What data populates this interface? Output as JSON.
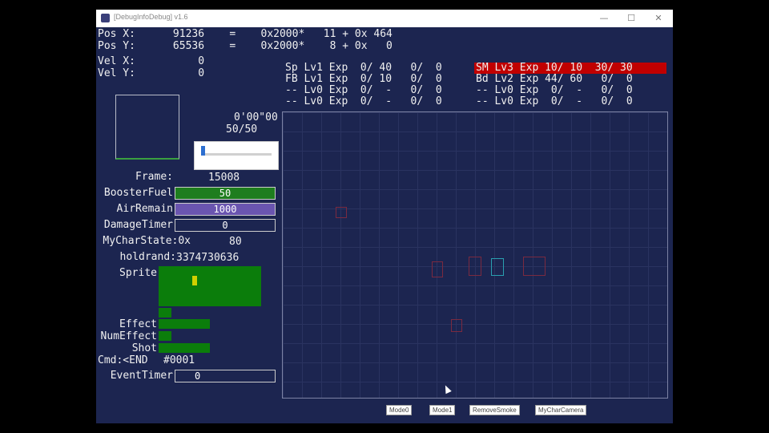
{
  "window": {
    "title": "[DebugInfoDebug] v1.6",
    "minimize": "—",
    "maximize": "☐",
    "close": "✕"
  },
  "pos": {
    "x_line": "Pos X:      91236    =    0x2000*   11 + 0x 464",
    "y_line": "Pos Y:      65536    =    0x2000*    8 + 0x   0"
  },
  "vel": {
    "x_line": "Vel X:          0",
    "y_line": "Vel Y:          0"
  },
  "weapons_left": [
    "Sp Lv1 Exp  0/ 40   0/  0",
    "FB Lv1 Exp  0/ 10   0/  0",
    "-- Lv0 Exp  0/  -   0/  0",
    "-- Lv0 Exp  0/  -   0/  0"
  ],
  "weapons_right": [
    "SM Lv3 Exp 10/ 10  30/ 30",
    "Bd Lv2 Exp 44/ 60   0/  0",
    "-- Lv0 Exp  0/  -   0/  0",
    "-- Lv0 Exp  0/  -   0/  0"
  ],
  "timer": {
    "time": "0'00\"00",
    "count": "50/50"
  },
  "stats": {
    "frame_label": "Frame:",
    "frame_value": "15008",
    "booster_label": "BoosterFuel",
    "booster_value": "50",
    "air_label": "AirRemain",
    "air_value": "1000",
    "damage_label": "DamageTimer",
    "damage_value": "0",
    "mychar_label": "MyCharState:0x",
    "mychar_value": "80",
    "holdrand_label": "holdrand:",
    "holdrand_value": "3374730636",
    "sprite_label": "Sprite",
    "effect_label": "Effect",
    "numeffect_label": "NumEffect",
    "shot_label": "Shot",
    "cmd_label": "Cmd:<END",
    "cmd_value": "#0001",
    "event_label": "EventTimer",
    "event_value": "0"
  },
  "colors": {
    "background": "#1c2550",
    "fuel": "#1e7d1e",
    "air": "#6a55b0",
    "highlight": "#c00000",
    "sprite": "#0b7d0b"
  },
  "checkboxes": [
    "Mode0",
    "Mode1",
    "RemoveSmoke",
    "MyCharCamera"
  ]
}
